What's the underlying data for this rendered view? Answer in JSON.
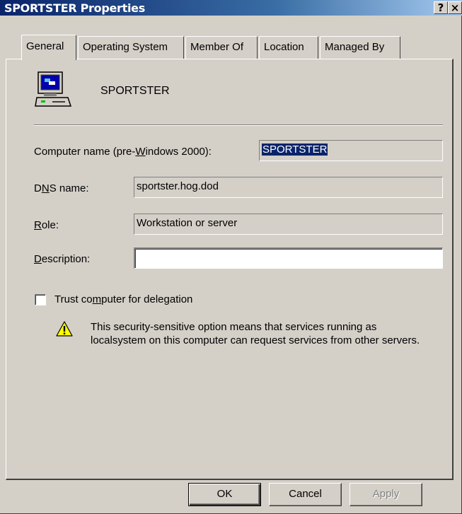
{
  "window": {
    "title": "SPORTSTER Properties",
    "help_glyph": "?",
    "close_glyph": "×"
  },
  "tabs": [
    {
      "label": "General",
      "active": true
    },
    {
      "label": "Operating System",
      "active": false
    },
    {
      "label": "Member Of",
      "active": false
    },
    {
      "label": "Location",
      "active": false
    },
    {
      "label": "Managed By",
      "active": false
    }
  ],
  "header": {
    "computer_name": "SPORTSTER",
    "icon": "computer-icon"
  },
  "fields": {
    "computer_name": {
      "label_pre": "Computer name (pre-",
      "label_ul": "W",
      "label_post": "indows 2000):",
      "value": "SPORTSTER"
    },
    "dns_name": {
      "label_pre": "D",
      "label_ul": "N",
      "label_post": "S name:",
      "value": "sportster.hog.dod"
    },
    "role": {
      "label_pre": "",
      "label_ul": "R",
      "label_post": "ole:",
      "value": "Workstation or server"
    },
    "description": {
      "label_pre": "",
      "label_ul": "D",
      "label_post": "escription:",
      "value": ""
    }
  },
  "delegation": {
    "label_pre": "Trust co",
    "label_ul": "m",
    "label_post": "puter for delegation",
    "checked": false,
    "warning_icon": "warning-icon",
    "warning_text": "This security-sensitive option means that services running as localsystem on this computer can request services from other servers."
  },
  "buttons": {
    "ok": "OK",
    "cancel": "Cancel",
    "apply": "Apply"
  }
}
